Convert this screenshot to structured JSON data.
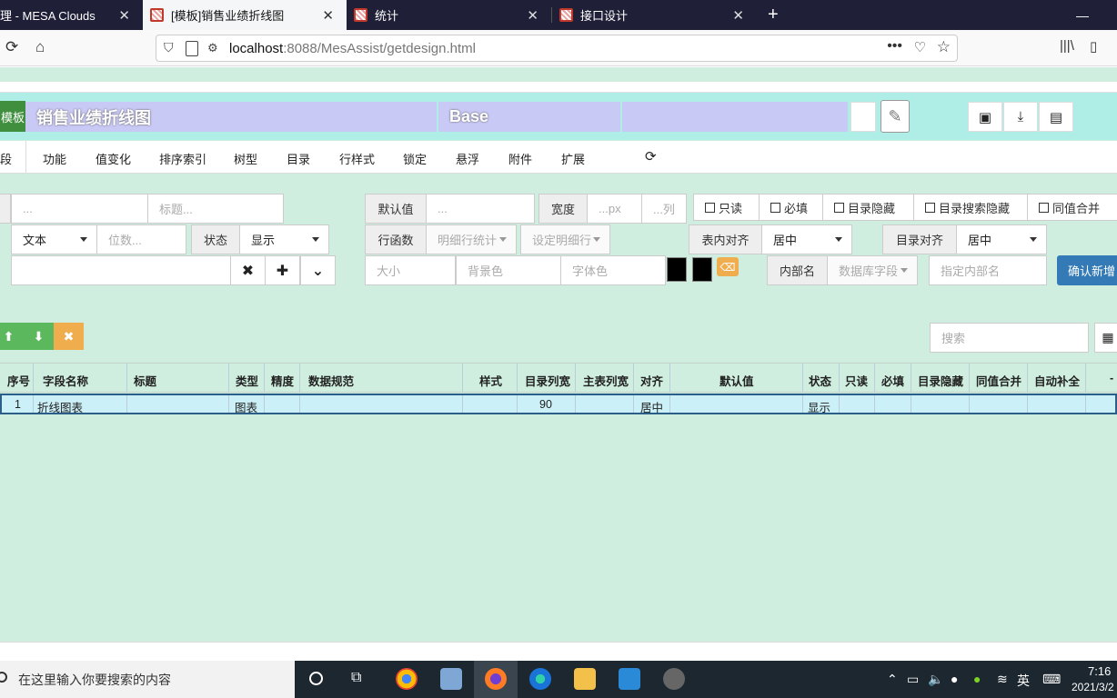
{
  "browser": {
    "tabs": [
      {
        "label": "理 - MESA Clouds"
      },
      {
        "label": "[模板]销售业绩折线图"
      },
      {
        "label": "统计"
      },
      {
        "label": "接口设计"
      }
    ],
    "url_host": "localhost",
    "url_rest": ":8088/MesAssist/getdesign.html"
  },
  "header": {
    "template_btn": "模板",
    "title": "销售业绩折线图",
    "base": "Base"
  },
  "menu": [
    "段",
    "功能",
    "值变化",
    "排序索引",
    "树型",
    "目录",
    "行样式",
    "锁定",
    "悬浮",
    "附件",
    "扩展"
  ],
  "form": {
    "field1_placeholder": "...",
    "title_placeholder": "标题...",
    "default_label": "默认值",
    "default_placeholder": "...",
    "width_label": "宽度",
    "width_px": "...px",
    "width_col": "...列",
    "checks": [
      "只读",
      "必填",
      "目录隐藏",
      "目录搜索隐藏",
      "同值合并"
    ],
    "type_value": "文本",
    "digits_placeholder": "位数...",
    "status_label": "状态",
    "status_value": "显示",
    "rowfunc_label": "行函数",
    "rowfunc_value": "明细行统计",
    "detail_value": "设定明细行",
    "inner_align_label": "表内对齐",
    "inner_align_value": "居中",
    "dir_align_label": "目录对齐",
    "dir_align_value": "居中",
    "size_placeholder": "大小",
    "bg_placeholder": "背景色",
    "font_color_placeholder": "字体色",
    "inner_name_label": "内部名",
    "db_field_value": "数据库字段",
    "inner_name_placeholder": "指定内部名",
    "confirm_label": "确认新增"
  },
  "toolbar": {
    "search_placeholder": "搜索"
  },
  "table": {
    "headers": [
      "序号",
      "字段名称",
      "标题",
      "类型",
      "精度",
      "数据规范",
      "样式",
      "目录列宽",
      "主表列宽",
      "对齐",
      "默认值",
      "状态",
      "只读",
      "必填",
      "目录隐藏",
      "同值合并",
      "自动补全",
      "-"
    ],
    "rows": [
      {
        "seq": "1",
        "name": "折线图表",
        "title": "",
        "type": "图表",
        "precision": "",
        "spec": "",
        "style": "",
        "dir_width": "90",
        "main_width": "",
        "align": "居中",
        "default": "",
        "status": "显示"
      }
    ]
  },
  "taskbar": {
    "search_text": "在这里输入你要搜索的内容",
    "ime": "英",
    "time": "7:16",
    "date": "2021/3/2"
  }
}
